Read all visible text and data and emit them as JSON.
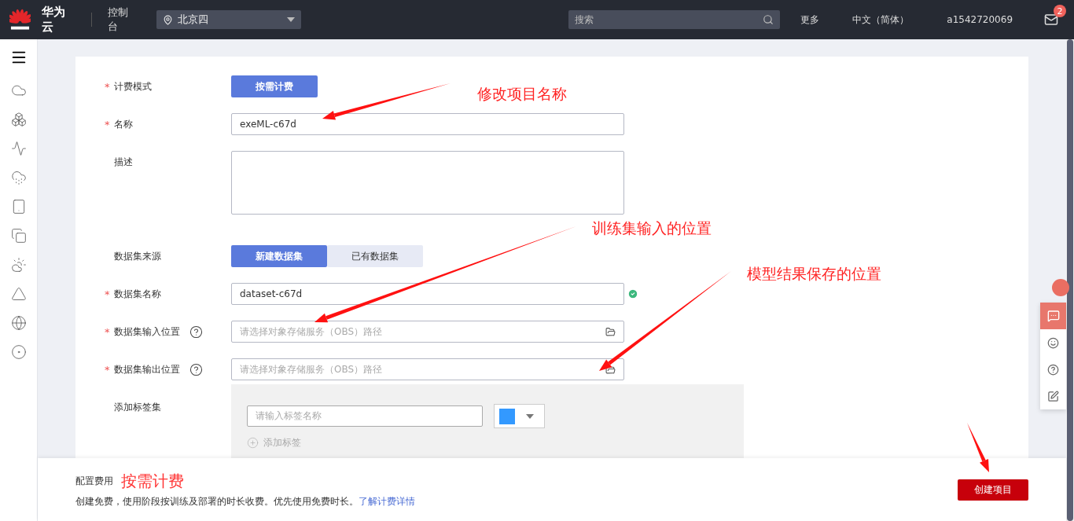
{
  "header": {
    "brand": "华为云",
    "console": "控制台",
    "region": "北京四",
    "search_placeholder": "搜索",
    "links": [
      "更多",
      "中文（简体）",
      "a1542720069"
    ],
    "mail_badge": "2"
  },
  "form": {
    "rows": [
      {
        "kind": "options",
        "label": "计费模式",
        "mark": "*",
        "options": [
          {
            "label": "按需计费",
            "selected": true
          }
        ]
      },
      {
        "kind": "input",
        "label": "名称",
        "mark": "*",
        "value": "exeML-c67d"
      },
      {
        "kind": "textarea",
        "label": "描述"
      },
      {
        "kind": "options",
        "label": "数据集来源",
        "options": [
          {
            "label": "新建数据集",
            "selected": true
          },
          {
            "label": "已有数据集",
            "selected": false
          }
        ]
      },
      {
        "kind": "input",
        "label": "数据集名称",
        "mark": "*",
        "value": "dataset-c67d",
        "valid": true
      },
      {
        "kind": "path",
        "label": "数据集输入位置",
        "mark": "*",
        "help": true,
        "placeholder": "请选择对象存储服务（OBS）路径"
      },
      {
        "kind": "path",
        "label": "数据集输出位置",
        "mark": "*",
        "help": true,
        "placeholder": "请选择对象存储服务（OBS）路径"
      },
      {
        "kind": "tags",
        "label": "添加标签集",
        "placeholder": "请输入标签名称",
        "color": "#3399ff",
        "add": "添加标签"
      }
    ]
  },
  "footer": {
    "label": "配置费用",
    "price": "按需计费",
    "note": "创建免费，使用阶段按训练及部署的时长收费。优先使用免费时长。",
    "link": "了解计费详情",
    "button": "创建项目"
  },
  "annotations": [
    {
      "kind": "labeled",
      "text": "修改项目名称"
    },
    {
      "kind": "labeled",
      "text": "训练集输入的位置"
    },
    {
      "kind": "labeled",
      "text": "模型结果保存的位置"
    },
    {
      "kind": "arrow"
    }
  ]
}
